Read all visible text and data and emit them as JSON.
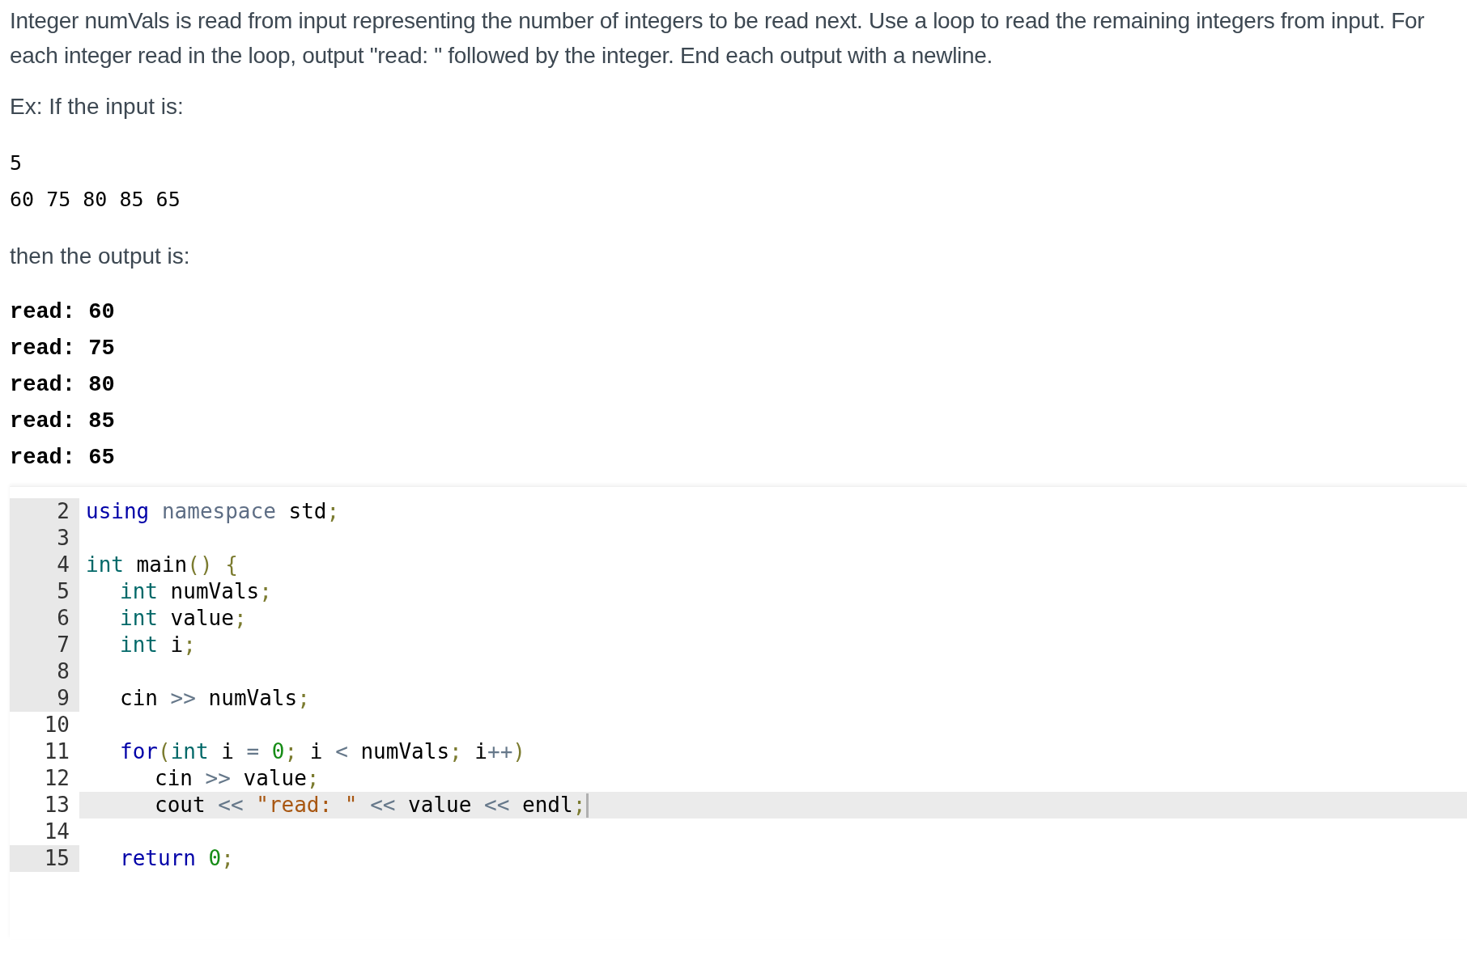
{
  "description": [
    "Integer numVals is read from input representing the number of integers to be read next. Use a loop to read the remaining integers from input. For each integer read in the loop, output \"read: \" followed by the integer. End each output with a newline."
  ],
  "example_label": "Ex: If the input is:",
  "example_input": [
    "5",
    "60 75 80 85 65"
  ],
  "output_label": "then the output is:",
  "example_output": [
    "read: 60",
    "read: 75",
    "read: 80",
    "read: 85",
    "read: 65"
  ],
  "code_editor": {
    "lines": [
      {
        "number": "2",
        "kind": "top",
        "shaded": true,
        "highlighted": false,
        "cursor": false,
        "tokens": [
          {
            "kind": "keyword",
            "text": "using"
          },
          {
            "kind": "namespace",
            "text": " namespace"
          },
          {
            "kind": "plain",
            "text": " std"
          },
          {
            "kind": "punct",
            "text": ";"
          }
        ]
      },
      {
        "number": "3",
        "kind": "top",
        "shaded": true,
        "highlighted": false,
        "cursor": false
      },
      {
        "number": "4",
        "kind": "top",
        "shaded": true,
        "highlighted": false,
        "cursor": false,
        "tokens": [
          {
            "kind": "type",
            "text": "int"
          },
          {
            "kind": "plain",
            "text": " main"
          },
          {
            "kind": "punct",
            "text": "() {"
          }
        ]
      },
      {
        "number": "5",
        "kind": "body",
        "shaded": true,
        "highlighted": false,
        "cursor": false,
        "tokens": [
          {
            "kind": "type",
            "text": "int"
          },
          {
            "kind": "plain",
            "text": " numVals"
          },
          {
            "kind": "punct",
            "text": ";"
          }
        ]
      },
      {
        "number": "6",
        "kind": "body",
        "shaded": true,
        "highlighted": false,
        "cursor": false,
        "tokens": [
          {
            "kind": "type",
            "text": "int"
          },
          {
            "kind": "plain",
            "text": " value"
          },
          {
            "kind": "punct",
            "text": ";"
          }
        ]
      },
      {
        "number": "7",
        "kind": "body",
        "shaded": true,
        "highlighted": false,
        "cursor": false,
        "tokens": [
          {
            "kind": "type",
            "text": "int"
          },
          {
            "kind": "plain",
            "text": " i"
          },
          {
            "kind": "punct",
            "text": ";"
          }
        ]
      },
      {
        "number": "8",
        "kind": "top",
        "shaded": true,
        "highlighted": false,
        "cursor": false
      },
      {
        "number": "9",
        "kind": "body",
        "shaded": true,
        "highlighted": false,
        "cursor": false,
        "tokens": [
          {
            "kind": "plain",
            "text": "cin"
          },
          {
            "kind": "operator",
            "text": " >>"
          },
          {
            "kind": "plain",
            "text": " numVals"
          },
          {
            "kind": "punct",
            "text": ";"
          }
        ]
      },
      {
        "number": "10",
        "kind": "top",
        "shaded": false,
        "highlighted": false,
        "cursor": false
      },
      {
        "number": "11",
        "kind": "body",
        "shaded": false,
        "highlighted": false,
        "cursor": false,
        "tokens": [
          {
            "kind": "keyword",
            "text": "for"
          },
          {
            "kind": "punct",
            "text": "("
          },
          {
            "kind": "type",
            "text": "int"
          },
          {
            "kind": "plain",
            "text": " i"
          },
          {
            "kind": "operator",
            "text": " ="
          },
          {
            "kind": "number",
            "text": " 0"
          },
          {
            "kind": "punct",
            "text": ";"
          },
          {
            "kind": "plain",
            "text": " i"
          },
          {
            "kind": "operator",
            "text": " <"
          },
          {
            "kind": "plain",
            "text": " numVals"
          },
          {
            "kind": "punct",
            "text": ";"
          },
          {
            "kind": "plain",
            "text": " i"
          },
          {
            "kind": "operator",
            "text": "++"
          },
          {
            "kind": "punct",
            "text": ")"
          }
        ]
      },
      {
        "number": "12",
        "kind": "nested",
        "shaded": false,
        "highlighted": false,
        "cursor": false,
        "tokens": [
          {
            "kind": "plain",
            "text": "cin"
          },
          {
            "kind": "operator",
            "text": " >>"
          },
          {
            "kind": "plain",
            "text": " value"
          },
          {
            "kind": "punct",
            "text": ";"
          }
        ]
      },
      {
        "number": "13",
        "kind": "nested",
        "shaded": false,
        "highlighted": true,
        "cursor": true,
        "tokens": [
          {
            "kind": "plain",
            "text": "cout"
          },
          {
            "kind": "operator",
            "text": " <<"
          },
          {
            "kind": "string",
            "text": " \"read: \""
          },
          {
            "kind": "operator",
            "text": " <<"
          },
          {
            "kind": "plain",
            "text": " value"
          },
          {
            "kind": "operator",
            "text": " <<"
          },
          {
            "kind": "plain",
            "text": " endl"
          },
          {
            "kind": "punct",
            "text": ";"
          }
        ]
      },
      {
        "number": "14",
        "kind": "top",
        "shaded": false,
        "highlighted": false,
        "cursor": false
      },
      {
        "number": "15",
        "kind": "body",
        "shaded": true,
        "highlighted": false,
        "cursor": false,
        "tokens": [
          {
            "kind": "keyword",
            "text": "return"
          },
          {
            "kind": "number",
            "text": " 0"
          },
          {
            "kind": "punct",
            "text": ";"
          }
        ]
      }
    ]
  }
}
